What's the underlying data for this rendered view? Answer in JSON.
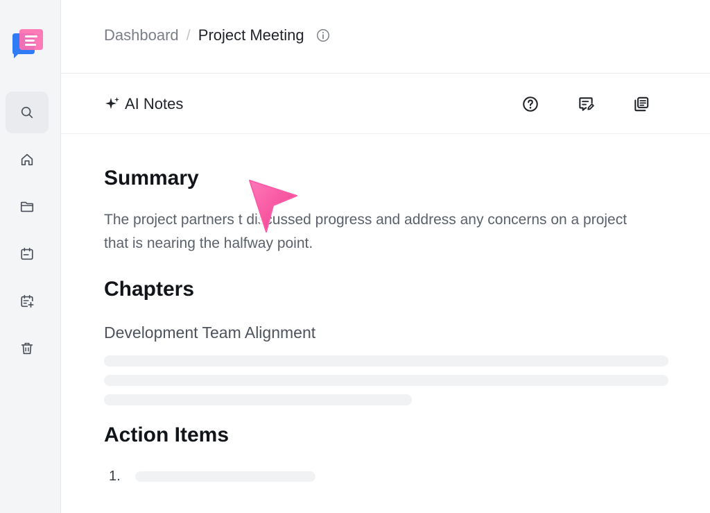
{
  "app": {
    "logo_icon": "app-logo-icon",
    "accent_color": "#ff4fa3"
  },
  "sidebar": {
    "items": [
      {
        "name": "search",
        "icon": "search-icon",
        "active": true
      },
      {
        "name": "home",
        "icon": "home-icon",
        "active": false
      },
      {
        "name": "folder",
        "icon": "folder-icon",
        "active": false
      },
      {
        "name": "calendar",
        "icon": "calendar-icon",
        "active": false
      },
      {
        "name": "schedule",
        "icon": "calendar-add-icon",
        "active": false
      },
      {
        "name": "trash",
        "icon": "trash-icon",
        "active": false
      }
    ]
  },
  "header": {
    "breadcrumb_parent": "Dashboard",
    "breadcrumb_separator": "/",
    "title": "Project Meeting"
  },
  "toolbar": {
    "ai_notes_label": "AI Notes",
    "icons": [
      "help-icon",
      "edit-note-icon",
      "copy-icon"
    ]
  },
  "main": {
    "summary_heading": "Summary",
    "summary_text": "The project partners t  discussed progress and address any concerns on a project that is nearing the halfway point.",
    "chapters_heading": "Chapters",
    "chapter_1": "Development Team Alignment",
    "action_items_heading": "Action Items",
    "action_item_1_number": "1."
  }
}
